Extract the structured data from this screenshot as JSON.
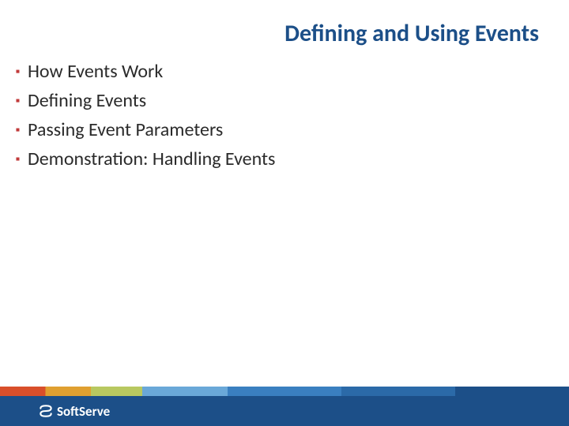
{
  "title": "Defining and Using Events",
  "bullets": [
    "How Events Work",
    "Defining Events",
    "Passing Event Parameters",
    "Demonstration: Handling Events"
  ],
  "footer": {
    "brand": "SoftServe"
  },
  "colors": {
    "title": "#1c4f88",
    "bullet_marker": "#c13a3a",
    "footer_bg": "#1c4f88"
  }
}
